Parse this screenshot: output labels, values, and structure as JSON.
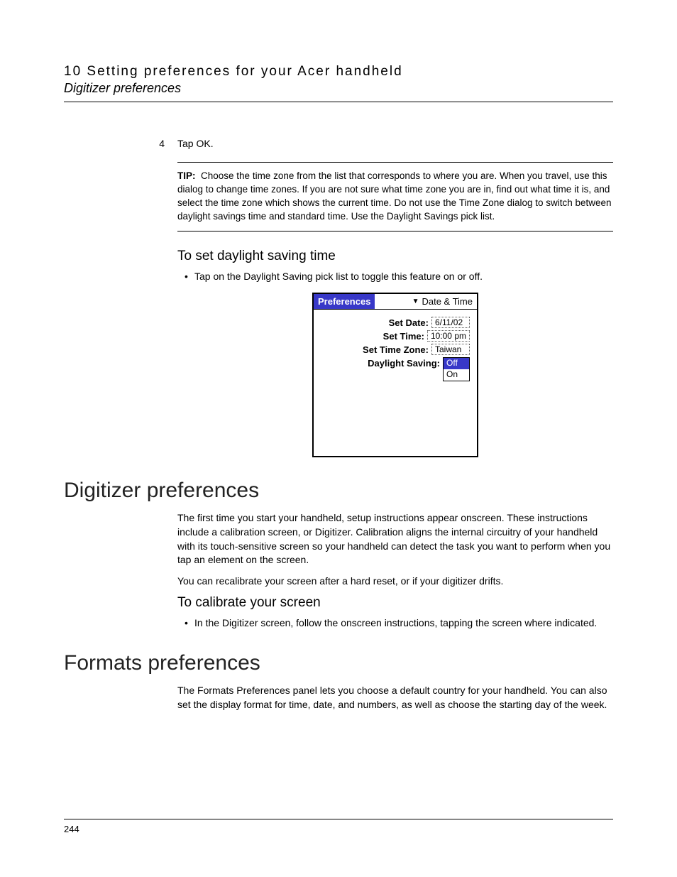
{
  "header": {
    "chapter": "10 Setting preferences for your Acer handheld",
    "section": "Digitizer preferences"
  },
  "step": {
    "num": "4",
    "text": "Tap OK."
  },
  "tip": {
    "label": "TIP:",
    "body": "Choose the time zone from the list that corresponds to where you are. When you travel, use this dialog to change time zones. If you are not sure what time zone you are in, find out what time it is, and select the time zone which shows the current time. Do not use the Time Zone dialog to switch between daylight savings time and standard time. Use the Daylight Savings pick list."
  },
  "dst": {
    "heading": "To set daylight saving time",
    "bullet": "Tap on the Daylight Saving pick list to toggle this feature on or off."
  },
  "palm": {
    "title": "Preferences",
    "category": "Date & Time",
    "rows": {
      "date_label": "Set Date:",
      "date_value": "6/11/02",
      "time_label": "Set Time:",
      "time_value": "10:00 pm",
      "tz_label": "Set Time Zone:",
      "tz_value": "Taiwan",
      "ds_label": "Daylight Saving:",
      "ds_off": "Off",
      "ds_on": "On"
    }
  },
  "digitizer": {
    "heading": "Digitizer preferences",
    "p1": "The first time you start your handheld, setup instructions appear onscreen. These instructions include a calibration screen, or Digitizer. Calibration aligns the internal circuitry of your handheld with its touch-sensitive screen so your handheld can detect the task you want to perform when you tap an element on the screen.",
    "p2": "You can recalibrate your screen after a hard reset, or if your digitizer drifts.",
    "sub": "To calibrate your screen",
    "bullet": "In the Digitizer screen, follow the onscreen instructions, tapping the screen where indicated."
  },
  "formats": {
    "heading": "Formats preferences",
    "p1": "The Formats Preferences panel lets you choose a default country for your handheld. You can also set the display format for time, date, and numbers, as well as choose the starting day of the week."
  },
  "footer": {
    "page": "244"
  }
}
